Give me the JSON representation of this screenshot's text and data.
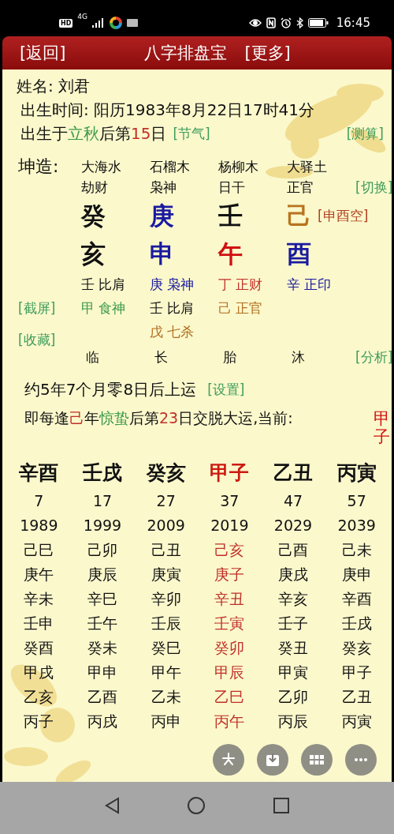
{
  "status_bar": {
    "badges": [
      "HD",
      "4G"
    ],
    "time": "16:45"
  },
  "header": {
    "back": "[返回]",
    "title": "八字排盘宝",
    "more": "[更多]"
  },
  "info": {
    "name": "姓名: 刘君",
    "birth_time": "出生时间: 阳历1983年8月22日17时41分",
    "solar_term": [
      {
        "text": "出生于",
        "color": "#111111"
      },
      {
        "text": "立秋",
        "color": "#3a9a4a"
      },
      {
        "text": "后第",
        "color": "#111111"
      },
      {
        "text": "15",
        "color": "#c0302a"
      },
      {
        "text": "日",
        "color": "#111111"
      }
    ],
    "term_link": "[节气]",
    "calc_link": "[测算]"
  },
  "chart": {
    "label": "坤造:",
    "switch_link": "[切换]",
    "void": "[申酉空]",
    "screenshot_link": "[截屏]",
    "save_link": "[收藏]",
    "analyze_link": "[分析]",
    "columns": [
      {
        "nayin": "大海水",
        "ten_god": "劫财",
        "stem": {
          "text": "癸",
          "color": "#111111"
        },
        "branch": {
          "text": "亥",
          "color": "#111111"
        },
        "hidden": [
          {
            "text": "壬 比肩",
            "color": "#111111"
          },
          {
            "text": "甲 食神",
            "color": "#3a9a4a"
          }
        ],
        "stage": "临"
      },
      {
        "nayin": "石榴木",
        "ten_god": "枭神",
        "stem": {
          "text": "庚",
          "color": "#1a1aa0"
        },
        "branch": {
          "text": "申",
          "color": "#1a1aa0"
        },
        "hidden": [
          {
            "text": "庚 枭神",
            "color": "#1a1aa0"
          },
          {
            "text": "壬 比肩",
            "color": "#111111"
          },
          {
            "text": "戊 七杀",
            "color": "#b07020"
          }
        ],
        "stage": "长"
      },
      {
        "nayin": "杨柳木",
        "ten_god": "日干",
        "stem": {
          "text": "壬",
          "color": "#111111"
        },
        "branch": {
          "text": "午",
          "color": "#d01010"
        },
        "hidden": [
          {
            "text": "丁 正财",
            "color": "#c0302a"
          },
          {
            "text": "己 正官",
            "color": "#b07020"
          }
        ],
        "stage": "胎"
      },
      {
        "nayin": "大驿土",
        "ten_god": "正官",
        "stem": {
          "text": "己",
          "color": "#b8741e"
        },
        "branch": {
          "text": "酉",
          "color": "#1a1aa0"
        },
        "hidden": [
          {
            "text": "辛 正印",
            "color": "#1a1aa0"
          }
        ],
        "stage": "沐"
      }
    ]
  },
  "luck": {
    "start": "约5年7个月零8日后上运",
    "settings_link": "[设置]",
    "rule": [
      {
        "text": "即每逢",
        "color": "#111111"
      },
      {
        "text": "己",
        "color": "#c0302a"
      },
      {
        "text": "年",
        "color": "#111111"
      },
      {
        "text": "惊蛰",
        "color": "#3a9a4a"
      },
      {
        "text": "后第",
        "color": "#111111"
      },
      {
        "text": "23",
        "color": "#c0302a"
      },
      {
        "text": "日交脱大运,当前:",
        "color": "#111111"
      }
    ],
    "current": "甲子"
  },
  "dayun": [
    {
      "pillar": "辛酉",
      "age": "7",
      "year": "1989",
      "selected": false,
      "years": [
        "己巳",
        "庚午",
        "辛未",
        "壬申",
        "癸酉",
        "甲戌",
        "乙亥",
        "丙子"
      ]
    },
    {
      "pillar": "壬戌",
      "age": "17",
      "year": "1999",
      "selected": false,
      "years": [
        "己卯",
        "庚辰",
        "辛巳",
        "壬午",
        "癸未",
        "甲申",
        "乙酉",
        "丙戌"
      ]
    },
    {
      "pillar": "癸亥",
      "age": "27",
      "year": "2009",
      "selected": false,
      "years": [
        "己丑",
        "庚寅",
        "辛卯",
        "壬辰",
        "癸巳",
        "甲午",
        "乙未",
        "丙申"
      ]
    },
    {
      "pillar": "甲子",
      "age": "37",
      "year": "2019",
      "selected": true,
      "years": [
        "己亥",
        "庚子",
        "辛丑",
        "壬寅",
        "癸卯",
        "甲辰",
        "乙巳",
        "丙午"
      ]
    },
    {
      "pillar": "乙丑",
      "age": "47",
      "year": "2029",
      "selected": false,
      "years": [
        "己酉",
        "庚戌",
        "辛亥",
        "壬子",
        "癸丑",
        "甲寅",
        "乙卯",
        "丙辰"
      ]
    },
    {
      "pillar": "丙寅",
      "age": "57",
      "year": "2039",
      "selected": false,
      "years": [
        "己未",
        "庚申",
        "辛酉",
        "壬戌",
        "癸亥",
        "甲子",
        "乙丑",
        "丙寅"
      ]
    }
  ],
  "floating_actions": [
    {
      "kind": "sparkle"
    },
    {
      "kind": "download"
    },
    {
      "kind": "grid"
    },
    {
      "kind": "more"
    }
  ]
}
